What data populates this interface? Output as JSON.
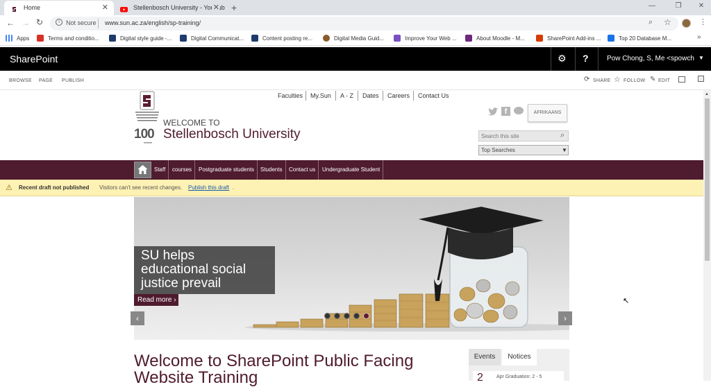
{
  "browser": {
    "tabs": [
      {
        "title": "Home",
        "active": true
      },
      {
        "title": "Stellenbosch University - YouTub",
        "active": false
      }
    ],
    "security": "Not secure",
    "url": "www.sun.ac.za/english/sp-training/",
    "bookmarks": [
      {
        "label": "Apps",
        "color": "#4285f4"
      },
      {
        "label": "Terms and conditio...",
        "color": "#d93025"
      },
      {
        "label": "Digital style guide -...",
        "color": "#1f3b6d"
      },
      {
        "label": "Digital Communicat...",
        "color": "#1f3b6d"
      },
      {
        "label": "Content posting re...",
        "color": "#1f3b6d"
      },
      {
        "label": "Digital Media Guid...",
        "color": "#8a5a2b"
      },
      {
        "label": "Improve Your Web ...",
        "color": "#7a4fc0"
      },
      {
        "label": "About Moodle - M...",
        "color": "#6b2a7a"
      },
      {
        "label": "SharePoint Add-ins ...",
        "color": "#d83b01"
      },
      {
        "label": "Top 20 Database M...",
        "color": "#1a73e8"
      }
    ]
  },
  "sharepoint": {
    "brand": "SharePoint",
    "user": "Pow Chong, S, Me <spowch",
    "ribbon_tabs": [
      "BROWSE",
      "PAGE",
      "PUBLISH"
    ],
    "actions": [
      "SHARE",
      "FOLLOW",
      "EDIT"
    ]
  },
  "site": {
    "logo_year": "100",
    "welcome_small": "WELCOME TO",
    "name": "Stellenbosch University",
    "top_links": [
      "Faculties",
      "My.Sun",
      "A - Z",
      "Dates",
      "Careers",
      "Contact Us"
    ],
    "language_button": "AFRIKAANS",
    "search_placeholder": "Search this site",
    "search_scope": "Top Searches",
    "nav": [
      "Staff",
      "courses",
      "Postgraduate students",
      "Students",
      "Contact us",
      "Undergraduate Student"
    ],
    "accent": "#4f1b2e"
  },
  "draft": {
    "title": "Recent draft not published",
    "message": "Visitors can't see recent changes.",
    "link": "Publish this draft",
    "end": "."
  },
  "hero": {
    "headline": [
      "SU helps",
      "educational social",
      "justice prevail"
    ],
    "cta": "Read more ›",
    "slides": 5,
    "active_slide": 5
  },
  "page": {
    "title_line1": "Welcome to SharePoint Public Facing",
    "title_line2": "Website Training",
    "tabs": [
      "Events",
      "Notices"
    ],
    "event_day": "2",
    "event_text": "Apr  Graduation: 2 - 5"
  }
}
